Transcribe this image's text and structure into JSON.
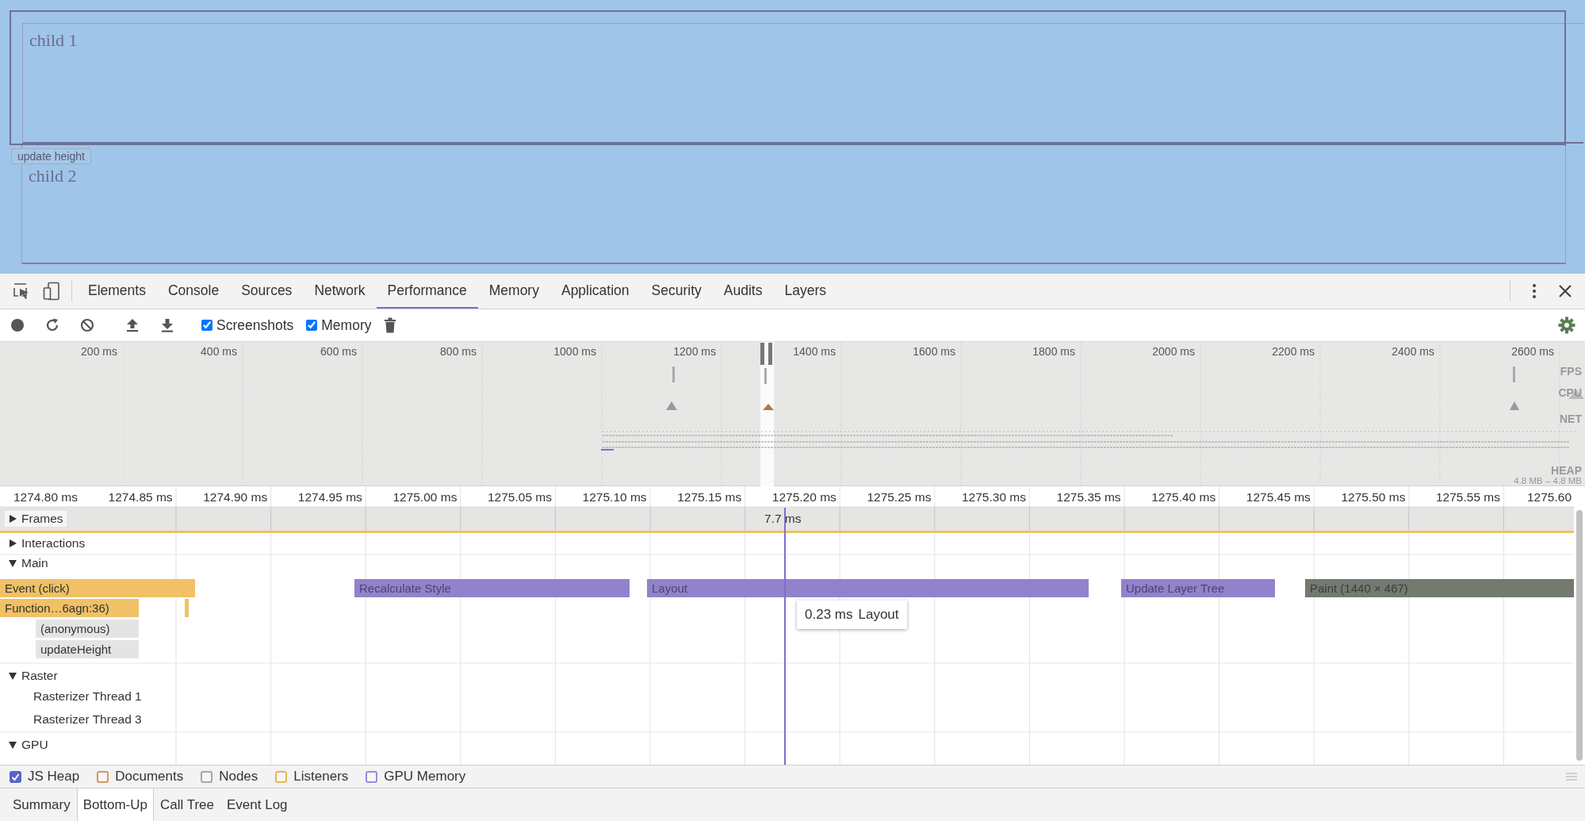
{
  "page": {
    "boxes": [
      {
        "label": "child 1"
      },
      {
        "label": "child 2"
      }
    ],
    "button": "update height"
  },
  "devtools": {
    "tabs": [
      {
        "label": "Elements",
        "selected": false
      },
      {
        "label": "Console",
        "selected": false
      },
      {
        "label": "Sources",
        "selected": false
      },
      {
        "label": "Network",
        "selected": false
      },
      {
        "label": "Performance",
        "selected": true
      },
      {
        "label": "Memory",
        "selected": false
      },
      {
        "label": "Application",
        "selected": false
      },
      {
        "label": "Security",
        "selected": false
      },
      {
        "label": "Audits",
        "selected": false
      },
      {
        "label": "Layers",
        "selected": false
      }
    ],
    "toolbar": {
      "checkboxes": [
        {
          "label": "Screenshots",
          "checked": true
        },
        {
          "label": "Memory",
          "checked": true
        }
      ]
    },
    "overview": {
      "ticks": [
        "200 ms",
        "400 ms",
        "600 ms",
        "800 ms",
        "1000 ms",
        "1200 ms",
        "1400 ms",
        "1600 ms",
        "1800 ms",
        "2000 ms",
        "2200 ms",
        "2400 ms",
        "2600 ms"
      ],
      "tracks": [
        "FPS",
        "CPU",
        "NET",
        "HEAP"
      ],
      "heap_range": "4.8 MB – 4.8 MB"
    },
    "timeline": {
      "ticks": [
        "1274.80 ms",
        "1274.85 ms",
        "1274.90 ms",
        "1274.95 ms",
        "1275.00 ms",
        "1275.05 ms",
        "1275.10 ms",
        "1275.15 ms",
        "1275.20 ms",
        "1275.25 ms",
        "1275.30 ms",
        "1275.35 ms",
        "1275.40 ms",
        "1275.45 ms",
        "1275.50 ms",
        "1275.55 ms",
        "1275.60"
      ],
      "frames": {
        "label": "Frames",
        "expanded": false,
        "duration": "7.7 ms"
      },
      "groups": [
        {
          "label": "Interactions",
          "expanded": false
        },
        {
          "label": "Main",
          "expanded": true,
          "events": [
            {
              "kind": "scripting",
              "label": "Event (click)"
            },
            {
              "kind": "rendering",
              "label": "Recalculate Style"
            },
            {
              "kind": "rendering",
              "label": "Layout"
            },
            {
              "kind": "rendering",
              "label": "Update Layer Tree"
            },
            {
              "kind": "painting",
              "label": "Paint (1440 × 467)"
            },
            {
              "kind": "scripting",
              "label": "Function…6agn:36)"
            },
            {
              "kind": "scripting"
            },
            {
              "kind": "stack",
              "label": "(anonymous)"
            },
            {
              "kind": "stack",
              "label": "updateHeight"
            }
          ]
        },
        {
          "label": "Raster",
          "expanded": true,
          "threads": [
            "Rasterizer Thread 1",
            "Rasterizer Thread 3"
          ]
        },
        {
          "label": "GPU",
          "expanded": true
        }
      ],
      "tooltip": {
        "duration": "0.23 ms",
        "label": "Layout"
      }
    },
    "legend": [
      {
        "label": "JS Heap",
        "checked": true,
        "color": "#5a64c8"
      },
      {
        "label": "Documents",
        "checked": false,
        "color": "#d9955a"
      },
      {
        "label": "Nodes",
        "checked": false,
        "color": "#a6a6a6"
      },
      {
        "label": "Listeners",
        "checked": false,
        "color": "#e2b55c"
      },
      {
        "label": "GPU Memory",
        "checked": false,
        "color": "#9b8ad8"
      }
    ],
    "bottom_tabs": [
      {
        "label": "Summary",
        "selected": false
      },
      {
        "label": "Bottom-Up",
        "selected": true
      },
      {
        "label": "Call Tree",
        "selected": false
      },
      {
        "label": "Event Log",
        "selected": false
      }
    ]
  }
}
